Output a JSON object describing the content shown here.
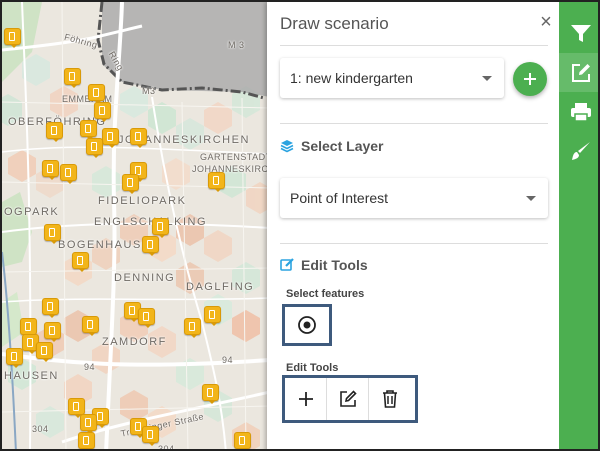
{
  "panel": {
    "title": "Draw scenario",
    "close_label": "×",
    "scenario_select": {
      "value": "1: new kindergarten"
    },
    "select_layer": {
      "heading": "Select Layer",
      "value": "Point of Interest"
    },
    "edit_tools": {
      "heading": "Edit Tools",
      "select_features_label": "Select features",
      "tools_label": "Edit Tools"
    }
  },
  "map": {
    "labels": [
      "ENGLSCHALKING",
      "BOGENHAUSEN",
      "DENNING",
      "DAGLFING",
      "ZAMDORF",
      "FIDELIOPARK",
      "JOHANNESKIRCHEN",
      "OBERFÖHRING",
      "GARTENSTADT",
      "JOHANNESKIRCHEN",
      "OGPARK",
      "EMMERAM",
      "HAUSEN",
      "Truderinger Straße",
      "Föhring",
      "Ring",
      "M 3",
      "M3"
    ],
    "road_numbers": [
      "94",
      "94",
      "304",
      "304"
    ]
  },
  "toolbar": {
    "buttons": [
      {
        "name": "filter-icon",
        "active": false
      },
      {
        "name": "edit-icon",
        "active": true
      },
      {
        "name": "print-icon",
        "active": false
      },
      {
        "name": "brush-icon",
        "active": false
      }
    ]
  },
  "colors": {
    "accent_green": "#4caf50",
    "poi_yellow": "#f2b51a",
    "highlight_blue": "#3e5a7d"
  }
}
